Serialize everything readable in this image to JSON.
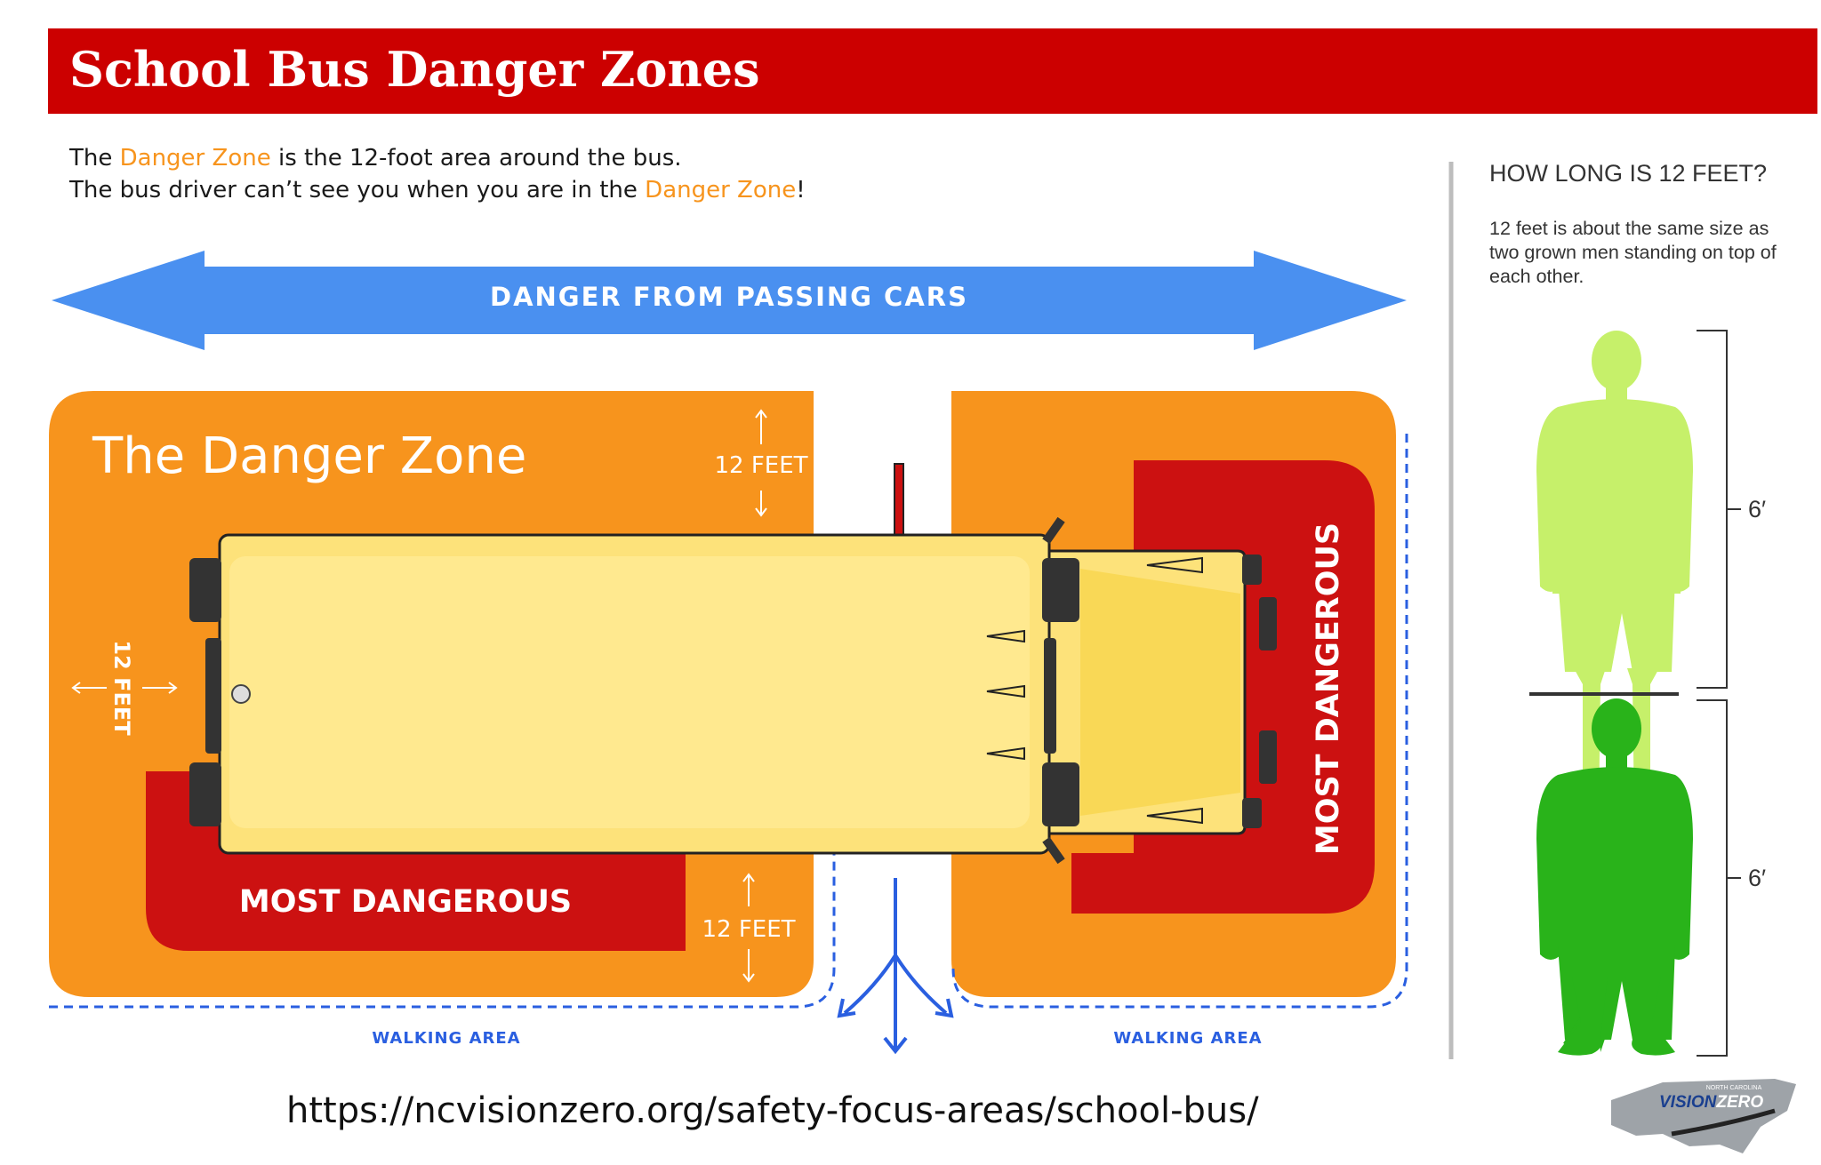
{
  "banner": {
    "title": "School Bus Danger Zones"
  },
  "intro": {
    "line1_before": "The ",
    "line1_highlight": "Danger Zone",
    "line1_after": " is the 12-foot area around the bus.",
    "line2_before": "The bus driver can’t see you when you are in the ",
    "line2_highlight": "Danger Zone",
    "line2_after": "!"
  },
  "arrow": {
    "label": "DANGER FROM PASSING CARS"
  },
  "zone": {
    "title": "The Danger Zone",
    "top_measure": "12 FEET",
    "bottom_measure": "12 FEET",
    "left_measure": "12 FEET",
    "most_dangerous_bottom": "MOST DANGEROUS",
    "most_dangerous_front": "MOST DANGEROUS"
  },
  "walking": {
    "left": "WALKING AREA",
    "right": "WALKING AREA"
  },
  "side": {
    "heading": "HOW LONG IS 12 FEET?",
    "text": "12 feet is about the same size as two grown men standing on top of each other.",
    "top_height": "6′",
    "bottom_height": "6′"
  },
  "footer": {
    "url": "https://ncvisionzero.org/safety-focus-areas/school-bus/"
  },
  "logo": {
    "small": "NORTH CAROLINA",
    "name_part1": "VISION",
    "name_part2": "ZERO"
  },
  "colors": {
    "banner_red": "#cc0000",
    "zone_orange": "#f7941d",
    "most_dangerous_red": "#cc1111",
    "arrow_blue": "#4a90f0",
    "walk_blue": "#2a5fe0",
    "bus_yellow": "#fde27a",
    "man_light_green": "#c6f06a",
    "man_dark_green": "#29b31a"
  }
}
